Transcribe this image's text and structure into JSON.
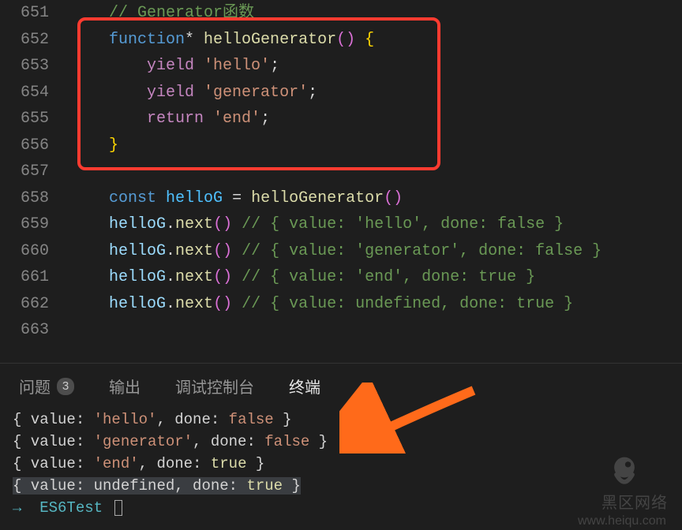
{
  "lines": [
    {
      "n": "651",
      "tokens": [
        [
          "    ",
          "punc"
        ],
        [
          "// Generator函数",
          "comment"
        ]
      ]
    },
    {
      "n": "652",
      "tokens": [
        [
          "    ",
          "punc"
        ],
        [
          "function",
          "keyword-decl"
        ],
        [
          "* ",
          "punc"
        ],
        [
          "helloGenerator",
          "fn"
        ],
        [
          "(",
          "paren"
        ],
        [
          ")",
          "paren"
        ],
        [
          " ",
          "punc"
        ],
        [
          "{",
          "brace"
        ]
      ]
    },
    {
      "n": "653",
      "tokens": [
        [
          "        ",
          "punc"
        ],
        [
          "yield",
          "keyword-ctrl"
        ],
        [
          " ",
          "punc"
        ],
        [
          "'hello'",
          "string"
        ],
        [
          ";",
          "punc"
        ]
      ]
    },
    {
      "n": "654",
      "tokens": [
        [
          "        ",
          "punc"
        ],
        [
          "yield",
          "keyword-ctrl"
        ],
        [
          " ",
          "punc"
        ],
        [
          "'generator'",
          "string"
        ],
        [
          ";",
          "punc"
        ]
      ]
    },
    {
      "n": "655",
      "tokens": [
        [
          "        ",
          "punc"
        ],
        [
          "return",
          "keyword-ctrl"
        ],
        [
          " ",
          "punc"
        ],
        [
          "'end'",
          "string"
        ],
        [
          ";",
          "punc"
        ]
      ]
    },
    {
      "n": "656",
      "tokens": [
        [
          "    ",
          "punc"
        ],
        [
          "}",
          "brace"
        ]
      ]
    },
    {
      "n": "657",
      "tokens": []
    },
    {
      "n": "658",
      "tokens": [
        [
          "    ",
          "punc"
        ],
        [
          "const",
          "keyword-decl"
        ],
        [
          " ",
          "punc"
        ],
        [
          "helloG",
          "const"
        ],
        [
          " = ",
          "punc"
        ],
        [
          "helloGenerator",
          "fn"
        ],
        [
          "(",
          "paren"
        ],
        [
          ")",
          "paren"
        ]
      ]
    },
    {
      "n": "659",
      "tokens": [
        [
          "    ",
          "punc"
        ],
        [
          "helloG",
          "var"
        ],
        [
          ".",
          "punc"
        ],
        [
          "next",
          "fn"
        ],
        [
          "(",
          "paren"
        ],
        [
          ")",
          "paren"
        ],
        [
          " ",
          "punc"
        ],
        [
          "// { value: 'hello', done: false }",
          "comment"
        ]
      ]
    },
    {
      "n": "660",
      "tokens": [
        [
          "    ",
          "punc"
        ],
        [
          "helloG",
          "var"
        ],
        [
          ".",
          "punc"
        ],
        [
          "next",
          "fn"
        ],
        [
          "(",
          "paren"
        ],
        [
          ")",
          "paren"
        ],
        [
          " ",
          "punc"
        ],
        [
          "// { value: 'generator', done: false }",
          "comment"
        ]
      ]
    },
    {
      "n": "661",
      "tokens": [
        [
          "    ",
          "punc"
        ],
        [
          "helloG",
          "var"
        ],
        [
          ".",
          "punc"
        ],
        [
          "next",
          "fn"
        ],
        [
          "(",
          "paren"
        ],
        [
          ")",
          "paren"
        ],
        [
          " ",
          "punc"
        ],
        [
          "// { value: 'end', done: true }",
          "comment"
        ]
      ]
    },
    {
      "n": "662",
      "tokens": [
        [
          "    ",
          "punc"
        ],
        [
          "helloG",
          "var"
        ],
        [
          ".",
          "punc"
        ],
        [
          "next",
          "fn"
        ],
        [
          "(",
          "paren"
        ],
        [
          ")",
          "paren"
        ],
        [
          " ",
          "punc"
        ],
        [
          "// { value: undefined, done: true }",
          "comment"
        ]
      ]
    },
    {
      "n": "663",
      "tokens": []
    }
  ],
  "tabs": {
    "problems": "问题",
    "problems_count": "3",
    "output": "输出",
    "debug": "调试控制台",
    "terminal": "终端"
  },
  "terminal": {
    "lines": [
      [
        [
          "{ value: ",
          ""
        ],
        [
          "'hello'",
          "t-str"
        ],
        [
          ", done: ",
          ""
        ],
        [
          "false",
          "t-bool-f"
        ],
        [
          " }",
          ""
        ]
      ],
      [
        [
          "{ value: ",
          ""
        ],
        [
          "'generator'",
          "t-str"
        ],
        [
          ", done: ",
          ""
        ],
        [
          "false",
          "t-bool-f"
        ],
        [
          " }",
          ""
        ]
      ],
      [
        [
          "{ value: ",
          ""
        ],
        [
          "'end'",
          "t-str"
        ],
        [
          ", done: ",
          ""
        ],
        [
          "true",
          "t-bool-t"
        ],
        [
          " }",
          ""
        ]
      ],
      [
        [
          "{ value: ",
          ""
        ],
        [
          "undefined",
          ""
        ],
        [
          ", done: ",
          ""
        ],
        [
          "true",
          "t-bool-t"
        ],
        [
          " }",
          ""
        ]
      ]
    ],
    "highlight_index": 3,
    "prompt_arrow": "→",
    "prompt_text": "ES6Test"
  },
  "watermark": {
    "brand": "黑区网络",
    "url": "www.heiqu.com"
  }
}
